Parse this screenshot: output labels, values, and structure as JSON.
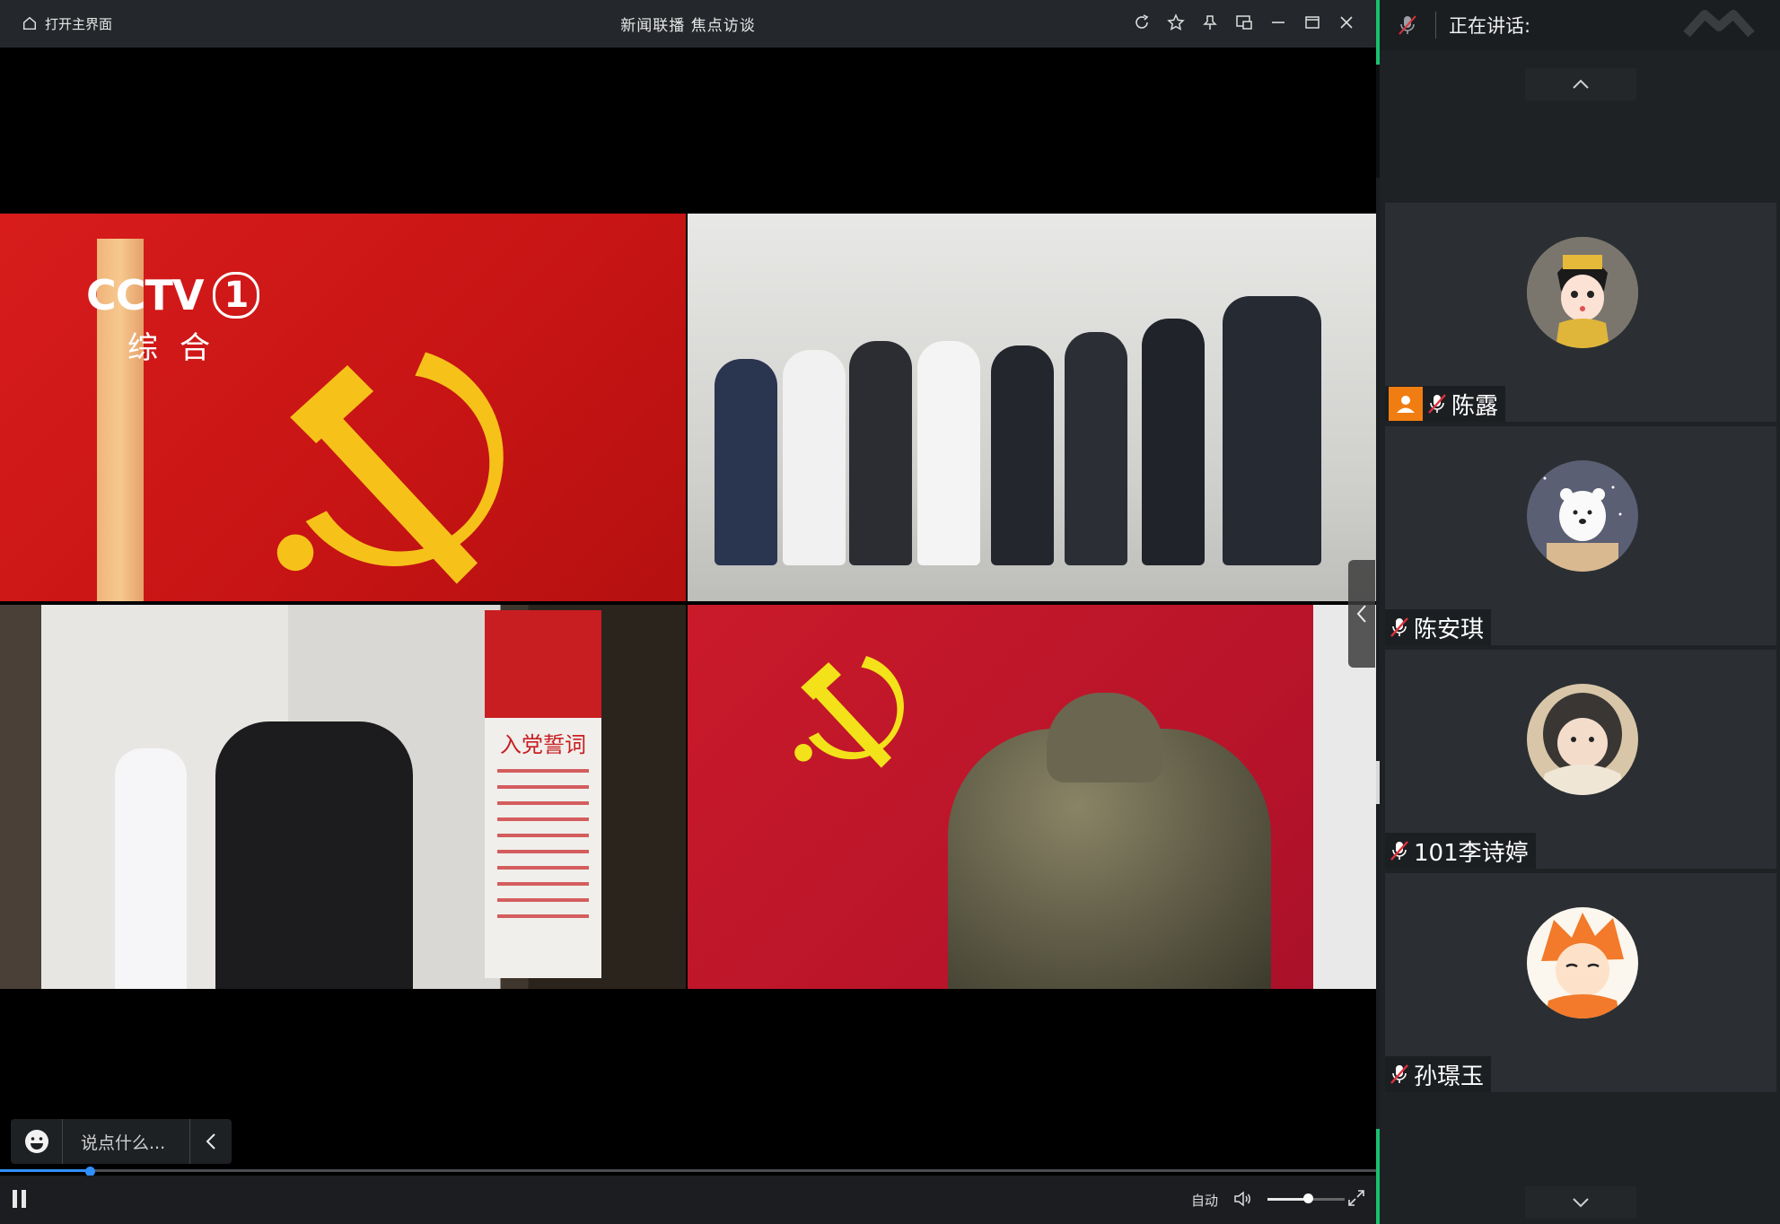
{
  "titlebar": {
    "home_label": "打开主界面",
    "title": "新闻联播  焦点访谈"
  },
  "video": {
    "channel_logo": "CCTV",
    "channel_number": "1",
    "channel_sub": "综合",
    "plaque_title": "入党誓词"
  },
  "chat": {
    "placeholder": "说点什么..."
  },
  "player": {
    "progress": 0.065,
    "quality_label": "自动",
    "volume": 0.52
  },
  "side": {
    "speaking_label": "正在讲话:",
    "participants": [
      {
        "name": "陈露",
        "host": true
      },
      {
        "name": "陈安琪",
        "host": false
      },
      {
        "name": "101李诗婷",
        "host": false
      },
      {
        "name": "孙璟玉",
        "host": false
      }
    ]
  },
  "colors": {
    "accent_green": "#19c06f",
    "progress_blue": "#2f8fff",
    "host_orange": "#f07d12",
    "mic_red": "#e0303a"
  }
}
